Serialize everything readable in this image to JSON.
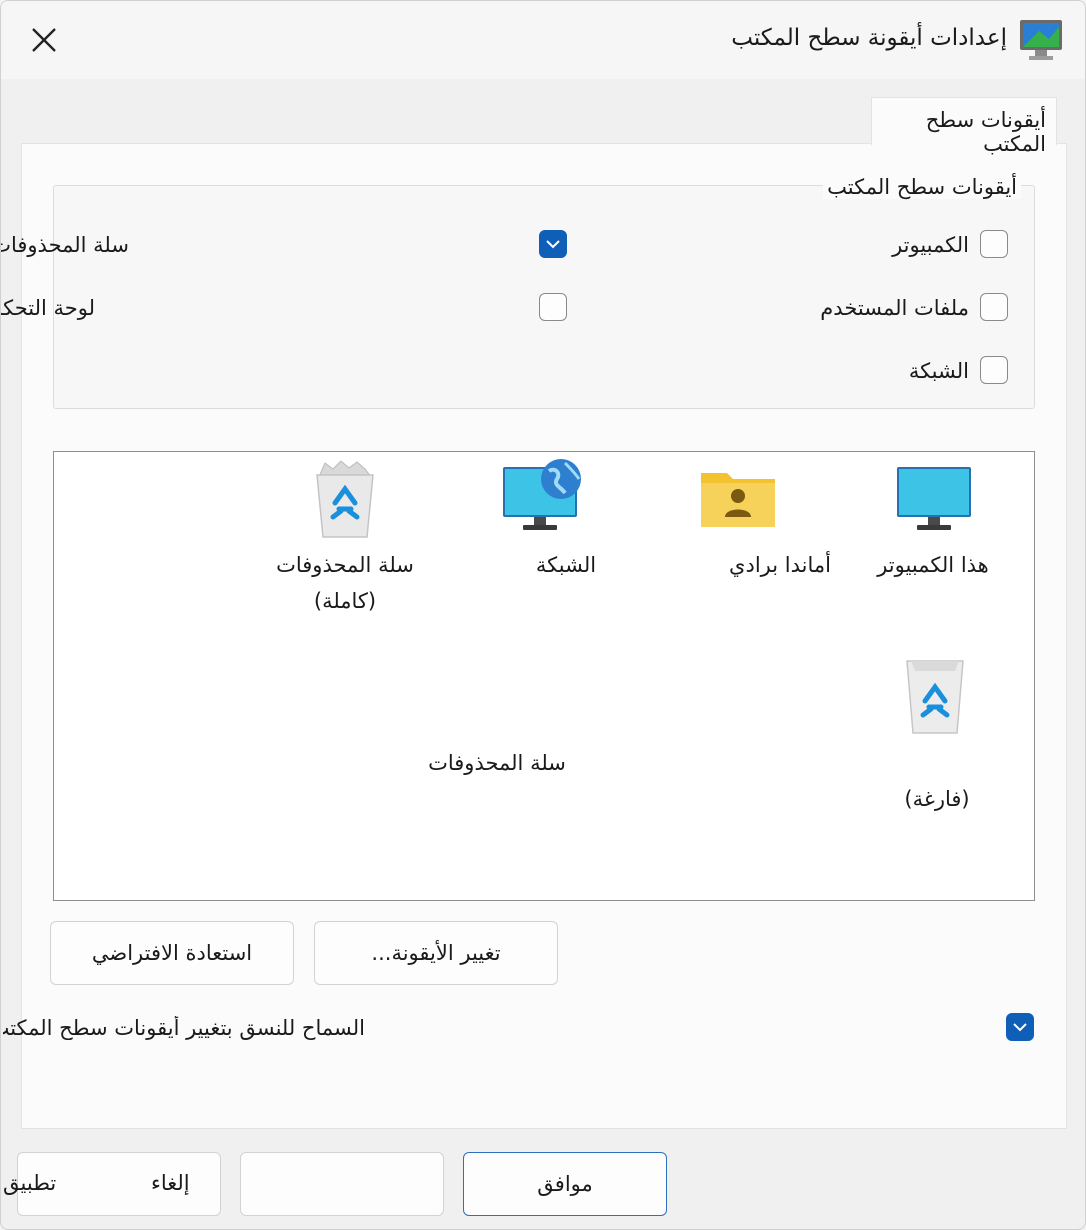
{
  "window": {
    "title": "إعدادات أيقونة سطح المكتب"
  },
  "tab": {
    "label": "أيقونات سطح المكتب"
  },
  "group": {
    "legend": "أيقونات سطح المكتب",
    "items": [
      {
        "label": "الكمبيوتر",
        "checked": false
      },
      {
        "label": "سلة المحذوفات",
        "checked": true
      },
      {
        "label": "ملفات المستخدم",
        "checked": false
      },
      {
        "label": "لوحة التحكم",
        "checked": false
      },
      {
        "label": "الشبكة",
        "checked": false
      }
    ]
  },
  "icons": [
    {
      "caption": "هذا الكمبيوتر",
      "icon": "monitor-icon"
    },
    {
      "caption": "أماندا برادي",
      "icon": "user-folder-icon"
    },
    {
      "caption": "الشبكة",
      "icon": "network-globe-icon"
    },
    {
      "caption_line1": "سلة المحذوفات",
      "caption_line2": "(كاملة)",
      "icon": "recycle-bin-full-icon"
    },
    {
      "caption": "سلة المحذوفات",
      "icon": "recycle-bin-empty-icon"
    },
    {
      "caption": "(فارغة)"
    }
  ],
  "buttons": {
    "change_icon": "تغيير الأيقونة...",
    "restore_default": "استعادة الافتراضي",
    "ok": "موافق",
    "cancel": "إلغاء",
    "apply": "تطبيق"
  },
  "allow_themes": {
    "label": "السماح للنسق بتغيير أيقونات سطح المكتب",
    "checked": true
  },
  "colors": {
    "accent": "#0f5fb8"
  }
}
